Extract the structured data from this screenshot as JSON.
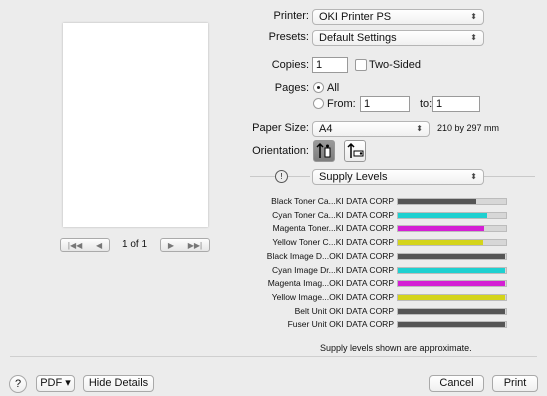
{
  "preview": {
    "page_label": "1 of 1",
    "first_glyph": "|◀◀",
    "prev_glyph": "◀",
    "next_glyph": "▶",
    "last_glyph": "▶▶|"
  },
  "printer": {
    "label": "Printer:",
    "value": "OKI Printer PS"
  },
  "presets": {
    "label": "Presets:",
    "value": "Default Settings"
  },
  "copies": {
    "label": "Copies:",
    "value": "1",
    "two_sided_label": "Two-Sided",
    "two_sided_checked": false
  },
  "pages": {
    "label": "Pages:",
    "all_label": "All",
    "from_label": "From:",
    "from_value": "1",
    "to_label": "to:",
    "to_value": "1",
    "selected": "All"
  },
  "paper_size": {
    "label": "Paper Size:",
    "value": "A4",
    "dims": "210 by 297 mm"
  },
  "orientation": {
    "label": "Orientation:",
    "selected": "portrait"
  },
  "section": {
    "value": "Supply Levels",
    "info_glyph": "!"
  },
  "supplies": [
    {
      "name": "Black Toner Ca...KI DATA CORP",
      "level": 0.72,
      "color": "#555555"
    },
    {
      "name": "Cyan Toner Ca...KI DATA CORP",
      "level": 0.82,
      "color": "#1ed0d0"
    },
    {
      "name": "Magenta Toner...KI DATA CORP",
      "level": 0.8,
      "color": "#d41fd4"
    },
    {
      "name": "Yellow Toner C...KI DATA CORP",
      "level": 0.79,
      "color": "#d4d41a"
    },
    {
      "name": "Black Image D...OKI DATA CORP",
      "level": 0.99,
      "color": "#555555"
    },
    {
      "name": "Cyan Image Dr...KI DATA CORP",
      "level": 0.99,
      "color": "#1ed0d0"
    },
    {
      "name": "Magenta Imag...OKI DATA CORP",
      "level": 0.99,
      "color": "#d41fd4"
    },
    {
      "name": "Yellow Image...OKI DATA CORP",
      "level": 0.99,
      "color": "#d4d41a"
    },
    {
      "name": "Belt Unit OKI DATA CORP",
      "level": 0.99,
      "color": "#555555"
    },
    {
      "name": "Fuser Unit OKI DATA CORP",
      "level": 0.99,
      "color": "#555555"
    }
  ],
  "supply_note": "Supply levels shown are approximate.",
  "footer": {
    "help_label": "?",
    "pdf_label": "PDF ▾",
    "hide_details_label": "Hide Details",
    "cancel_label": "Cancel",
    "print_label": "Print"
  }
}
